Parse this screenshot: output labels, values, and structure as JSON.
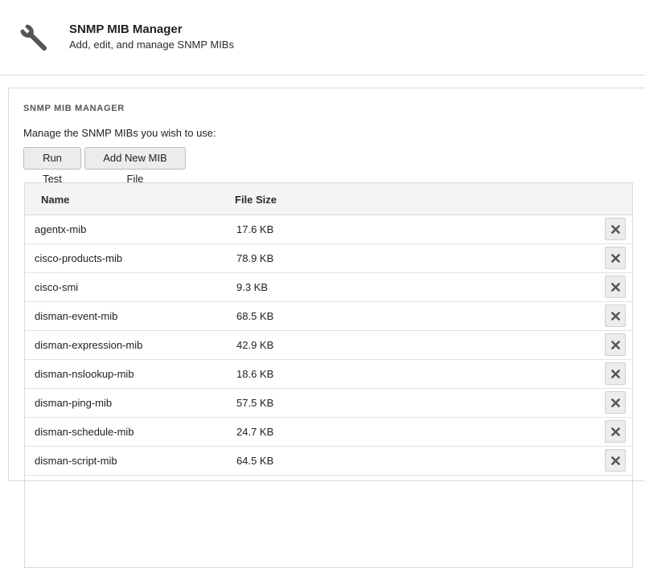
{
  "header": {
    "title": "SNMP MIB Manager",
    "subtitle": "Add, edit, and manage SNMP MIBs",
    "icon": "wrench-icon"
  },
  "panel": {
    "title": "SNMP MIB MANAGER",
    "description": "Manage the SNMP MIBs you wish to use:",
    "buttons": {
      "run_test": "Run Test",
      "add_new": "Add New MIB File"
    }
  },
  "table": {
    "columns": [
      "Name",
      "File Size"
    ],
    "rows": [
      {
        "name": "agentx-mib",
        "size": "17.6 KB"
      },
      {
        "name": "cisco-products-mib",
        "size": "78.9 KB"
      },
      {
        "name": "cisco-smi",
        "size": "9.3 KB"
      },
      {
        "name": "disman-event-mib",
        "size": "68.5 KB"
      },
      {
        "name": "disman-expression-mib",
        "size": "42.9 KB"
      },
      {
        "name": "disman-nslookup-mib",
        "size": "18.6 KB"
      },
      {
        "name": "disman-ping-mib",
        "size": "57.5 KB"
      },
      {
        "name": "disman-schedule-mib",
        "size": "24.7 KB"
      },
      {
        "name": "disman-script-mib",
        "size": "64.5 KB"
      }
    ],
    "row_action_icon": "close-icon"
  },
  "colors": {
    "icon": "#555555",
    "button_bg": "#ececec",
    "header_row_bg": "#f4f4f4",
    "border": "#d9d9d9"
  }
}
